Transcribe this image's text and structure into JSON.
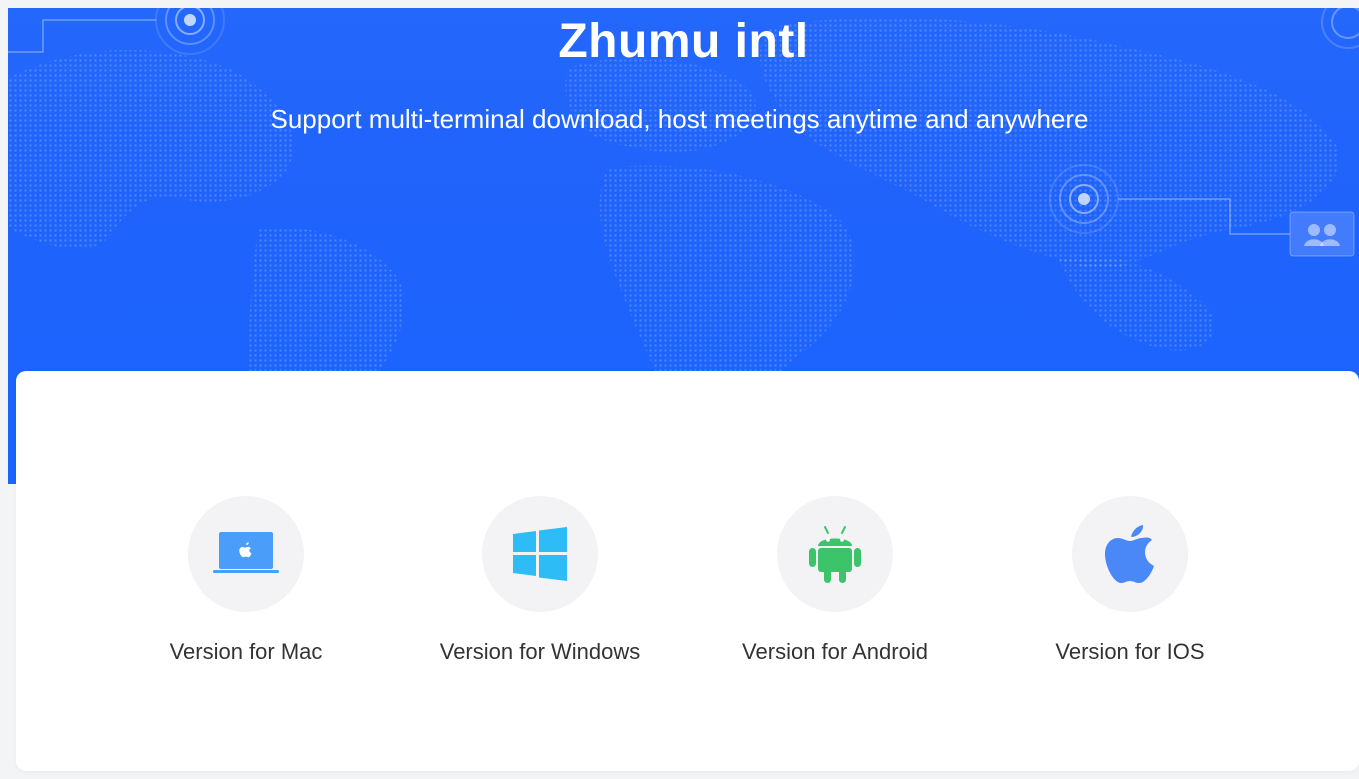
{
  "hero": {
    "title": "Zhumu intl",
    "subtitle": "Support multi-terminal download, host meetings anytime and anywhere"
  },
  "downloads": [
    {
      "label": "Version for Mac",
      "icon": "mac-laptop-icon",
      "color": "#4a9df8"
    },
    {
      "label": "Version for Windows",
      "icon": "windows-logo-icon",
      "color": "#2dbcf5"
    },
    {
      "label": "Version for Android",
      "icon": "android-robot-icon",
      "color": "#3cc46a"
    },
    {
      "label": "Version for IOS",
      "icon": "apple-logo-icon",
      "color": "#4a88f8"
    }
  ],
  "colors": {
    "hero_blue": "#1f63fb",
    "card_bg": "#ffffff",
    "icon_circle": "#f3f3f5"
  }
}
